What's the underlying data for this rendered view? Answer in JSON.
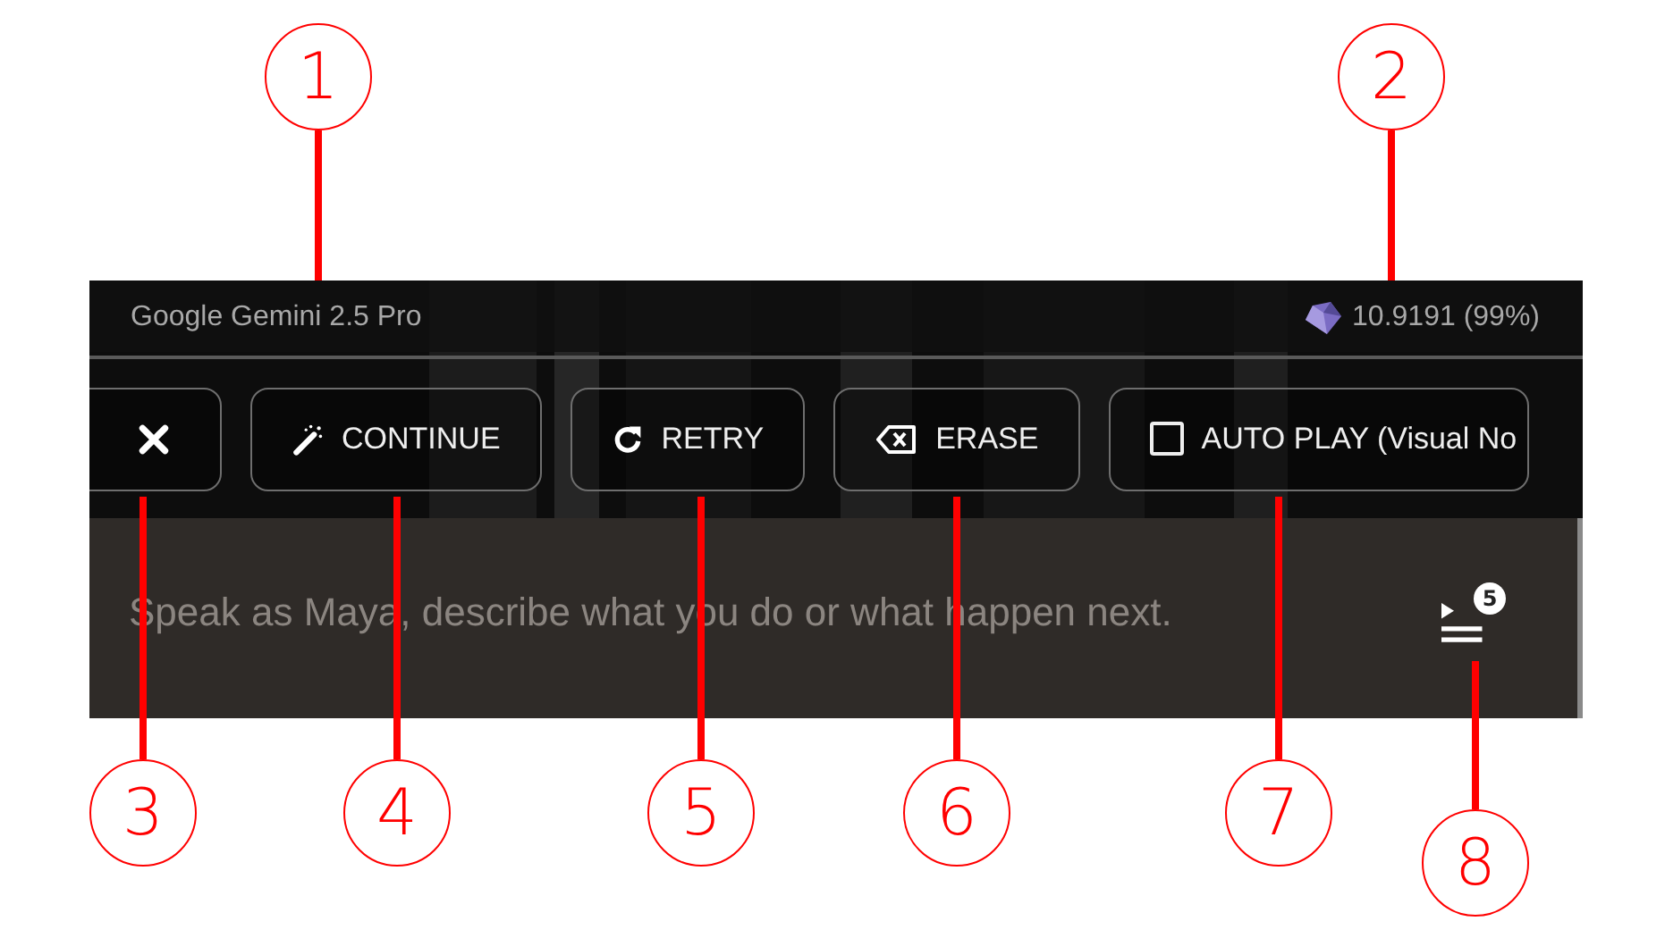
{
  "header": {
    "model": "Google Gemini 2.5 Pro",
    "balance": "10.9191 (99%)"
  },
  "buttons": [
    {
      "kind": "tools"
    },
    {
      "kind": "wand",
      "label": "CONTINUE"
    },
    {
      "kind": "retry",
      "label": "RETRY"
    },
    {
      "kind": "erase",
      "label": "ERASE"
    },
    {
      "kind": "checkbox",
      "label": "AUTO PLAY (Visual No",
      "checked": false
    }
  ],
  "input": {
    "placeholder": "Speak as Maya, describe what you do or what happen next."
  },
  "queue": {
    "count": "5"
  },
  "callouts": [
    {
      "number": "1"
    },
    {
      "number": "2"
    },
    {
      "number": "3"
    },
    {
      "number": "4"
    },
    {
      "number": "5"
    },
    {
      "number": "6"
    },
    {
      "number": "7"
    },
    {
      "number": "8"
    }
  ]
}
